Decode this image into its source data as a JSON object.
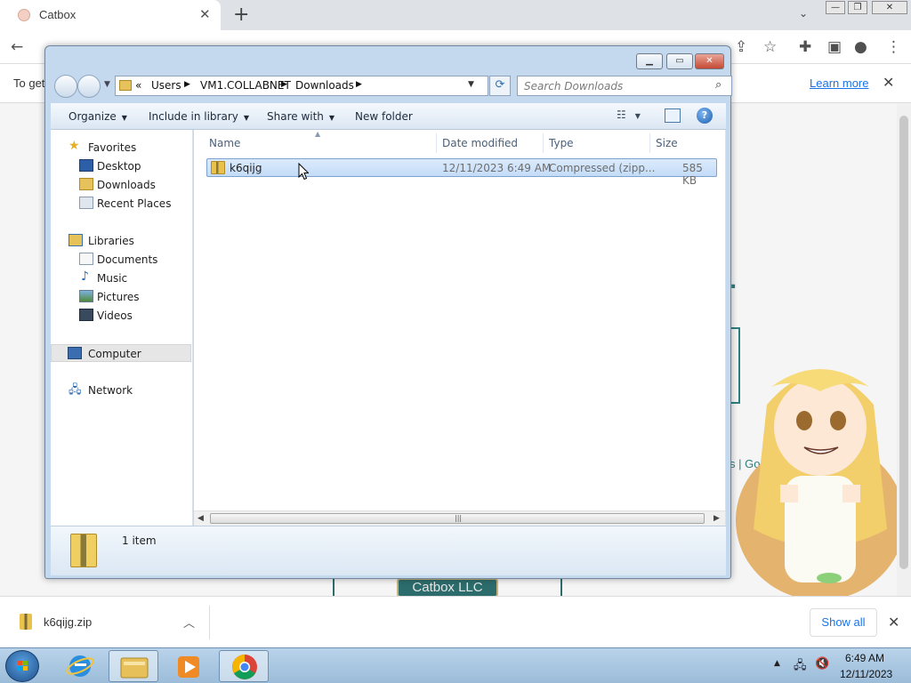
{
  "browser": {
    "tab_title": "Catbox",
    "infobar_text": "To get",
    "learn_more": "Learn more",
    "page_links": "s | Go Dark?",
    "catbox_llc": "Catbox LLC",
    "download_filename": "k6qijg.zip",
    "show_all": "Show all"
  },
  "explorer": {
    "breadcrumb": [
      "Users",
      "VM1.COLLABNET",
      "Downloads"
    ],
    "breadcrumb_prefix": "«",
    "search_placeholder": "Search Downloads",
    "commands": {
      "organize": "Organize",
      "include_in_library": "Include in library",
      "share_with": "Share with",
      "new_folder": "New folder"
    },
    "nav_pane": {
      "favorites": "Favorites",
      "desktop": "Desktop",
      "downloads": "Downloads",
      "recent_places": "Recent Places",
      "libraries": "Libraries",
      "documents": "Documents",
      "music": "Music",
      "pictures": "Pictures",
      "videos": "Videos",
      "computer": "Computer",
      "network": "Network"
    },
    "columns": {
      "name": "Name",
      "date_modified": "Date modified",
      "type": "Type",
      "size": "Size"
    },
    "files": [
      {
        "name": "k6qijg",
        "date_modified": "12/11/2023 6:49 AM",
        "type": "Compressed (zipp...",
        "size": "585 KB",
        "icon": "zip-folder-icon"
      }
    ],
    "status": "1 item"
  },
  "taskbar": {
    "time": "6:49 AM",
    "date": "12/11/2023"
  },
  "colors": {
    "accent_link": "#1a73e8",
    "catbox_teal": "#2d7e7e",
    "selection_border": "#7da2ce"
  }
}
